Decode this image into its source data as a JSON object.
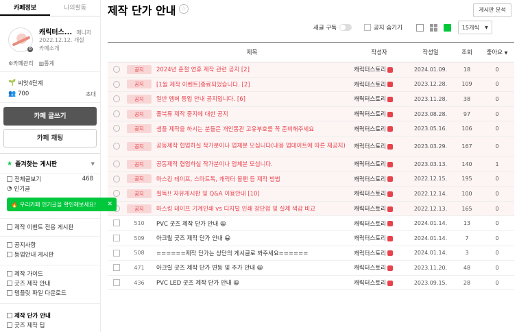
{
  "sidebar": {
    "tabs": [
      "카페정보",
      "나의활동"
    ],
    "cafe": {
      "name": "캐릭터스...",
      "role": "매니저",
      "created": "2022.12.12. 개설",
      "intro": "카페소개"
    },
    "links": [
      "카페관리",
      "통계"
    ],
    "level": "씨앗4단계",
    "members": "700",
    "invite": "초대",
    "write_button": "카페 글쓰기",
    "chat_button": "카페 채팅",
    "favorites": "즐겨찾는 게시판",
    "menu": [
      {
        "label": "전체글보기",
        "count": "468"
      },
      {
        "label": "인기글",
        "count": ""
      },
      {
        "label": "제작 이벤트 전용 게시판",
        "count": ""
      },
      {
        "label": "공지사항",
        "count": ""
      },
      {
        "label": "등업안내 게시판",
        "count": ""
      },
      {
        "label": "제작 가이드",
        "count": ""
      },
      {
        "label": "굿즈 제작 안내",
        "count": ""
      },
      {
        "label": "템플릿 파일 다운로드",
        "count": ""
      },
      {
        "label": "제작 단가 안내",
        "count": ""
      },
      {
        "label": "굿즈 제작 팁",
        "count": ""
      }
    ],
    "toast": "우리카페 인기글을 확인해보세요!"
  },
  "main": {
    "title": "제작 단가 안내",
    "analysis_button": "게시판 분석",
    "subscribe_label": "새글 구독",
    "hide_notice_label": "공지 숨기기",
    "page_size": "15개씩",
    "columns": [
      "제목",
      "작성자",
      "작성일",
      "조회",
      "좋아요"
    ],
    "rows": [
      {
        "badge": "공지",
        "num": "",
        "title": "2024년 춘절 연휴 제작 관련 공지 [2]",
        "author": "캐릭터스토리",
        "date": "2024.01.09.",
        "views": "18",
        "likes": "0",
        "notice": true
      },
      {
        "badge": "공지",
        "num": "",
        "title": "[1월 제작 이벤트]종료되었습니다. [2]",
        "author": "캐릭터스토리",
        "date": "2023.12.28.",
        "views": "109",
        "likes": "0",
        "notice": true
      },
      {
        "badge": "공지",
        "num": "",
        "title": "일반 멤버 등업 안내 공지입니다. [6]",
        "author": "캐릭터스토리",
        "date": "2023.11.28.",
        "views": "38",
        "likes": "0",
        "notice": true
      },
      {
        "badge": "공지",
        "num": "",
        "title": "졸북류 제작 중지에 대한 공지",
        "author": "캐릭터스토리",
        "date": "2023.08.28.",
        "views": "97",
        "likes": "0",
        "notice": true
      },
      {
        "badge": "공지",
        "num": "",
        "title": "샘플 제작을 하시는 분들은 개인통관 고유부호를 꼭 준비해주세요",
        "author": "캐릭터스토리",
        "date": "2023.05.16.",
        "views": "106",
        "likes": "0",
        "notice": true
      },
      {
        "badge": "공지",
        "num": "",
        "title": "공동제작 협업하실 작가분이나 업체분 모십니다(내용 업데이트에 따른 재공지)",
        "author": "캐릭터스토리",
        "date": "2023.03.29.",
        "views": "167",
        "likes": "0",
        "notice": true,
        "wrap": true
      },
      {
        "badge": "공지",
        "num": "",
        "title": "공동제작 협업하실 작가분이나 업체분 모십니다.",
        "author": "캐릭터스토리",
        "date": "2023.03.13.",
        "views": "140",
        "likes": "1",
        "notice": true
      },
      {
        "badge": "공지",
        "num": "",
        "title": "마스킹 테이프, 스마트톡, 캐릭터 볼팬 등 제작 방법",
        "author": "캐릭터스토리",
        "date": "2022.12.15.",
        "views": "195",
        "likes": "0",
        "notice": true
      },
      {
        "badge": "공지",
        "num": "",
        "title": "필독!! 자유게시판 및 Q&A 이용안내 [10]",
        "author": "캐릭터스토리",
        "date": "2022.12.14.",
        "views": "100",
        "likes": "0",
        "notice": true
      },
      {
        "badge": "공지",
        "num": "",
        "title": "마스킹 테이프 기계인쇄 vs 디지털 인쇄 장단점 및 실제 색감 비교",
        "author": "캐릭터스토리",
        "date": "2022.12.13.",
        "views": "165",
        "likes": "0",
        "notice": true
      },
      {
        "badge": "",
        "num": "510",
        "title": "PVC 굿즈 제작 단가 안내 😀",
        "author": "캐릭터스토리",
        "date": "2024.01.14.",
        "views": "13",
        "likes": "0",
        "notice": false
      },
      {
        "badge": "",
        "num": "509",
        "title": "아크릴 굿즈 제작 단가 안내 😀",
        "author": "캐릭터스토리",
        "date": "2024.01.14.",
        "views": "7",
        "likes": "0",
        "notice": false
      },
      {
        "badge": "",
        "num": "508",
        "title": "======제작 단가는 상단의 게시글로 봐주세요======",
        "author": "캐릭터스토리",
        "date": "2024.01.14.",
        "views": "3",
        "likes": "0",
        "notice": false
      },
      {
        "badge": "",
        "num": "471",
        "title": "아크릴 굿즈 제작 단가 변동 및 추가 안내 😀",
        "author": "캐릭터스토리",
        "date": "2023.11.20.",
        "views": "48",
        "likes": "0",
        "notice": false
      },
      {
        "badge": "",
        "num": "436",
        "title": "PVC LED 굿즈 제작 단가 안내 😀",
        "author": "캐릭터스토리",
        "date": "2023.09.15.",
        "views": "28",
        "likes": "0",
        "notice": false
      }
    ]
  }
}
